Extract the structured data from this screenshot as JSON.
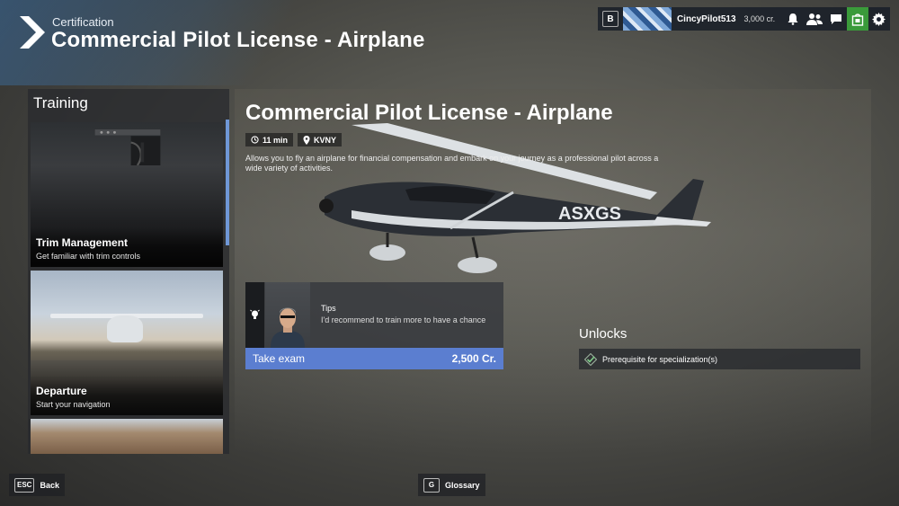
{
  "header": {
    "subtitle": "Certification",
    "title": "Commercial Pilot License - Airplane"
  },
  "topbar": {
    "key": "B",
    "username": "CincyPilot513",
    "credits": "3,000 cr."
  },
  "training": {
    "title": "Training",
    "cards": [
      {
        "title": "Trim Management",
        "desc": "Get familiar with trim controls"
      },
      {
        "title": "Departure",
        "desc": "Start your navigation"
      }
    ]
  },
  "detail": {
    "title": "Commercial Pilot License - Airplane",
    "duration": "11 min",
    "airport": "KVNY",
    "description": "Allows you to fly an airplane for financial compensation and embark on your journey as a professional pilot across a wide variety of activities.",
    "aircraft_tail": "ASXGS",
    "tips_heading": "Tips",
    "tips_text": "I'd recommend to train more to have a chance",
    "exam_label": "Take exam",
    "exam_price": "2,500 Cr.",
    "unlocks_title": "Unlocks",
    "unlock_item": "Prerequisite for specialization(s)"
  },
  "footer": {
    "back_key": "ESC",
    "back_label": "Back",
    "glossary_key": "G",
    "glossary_label": "Glossary"
  }
}
